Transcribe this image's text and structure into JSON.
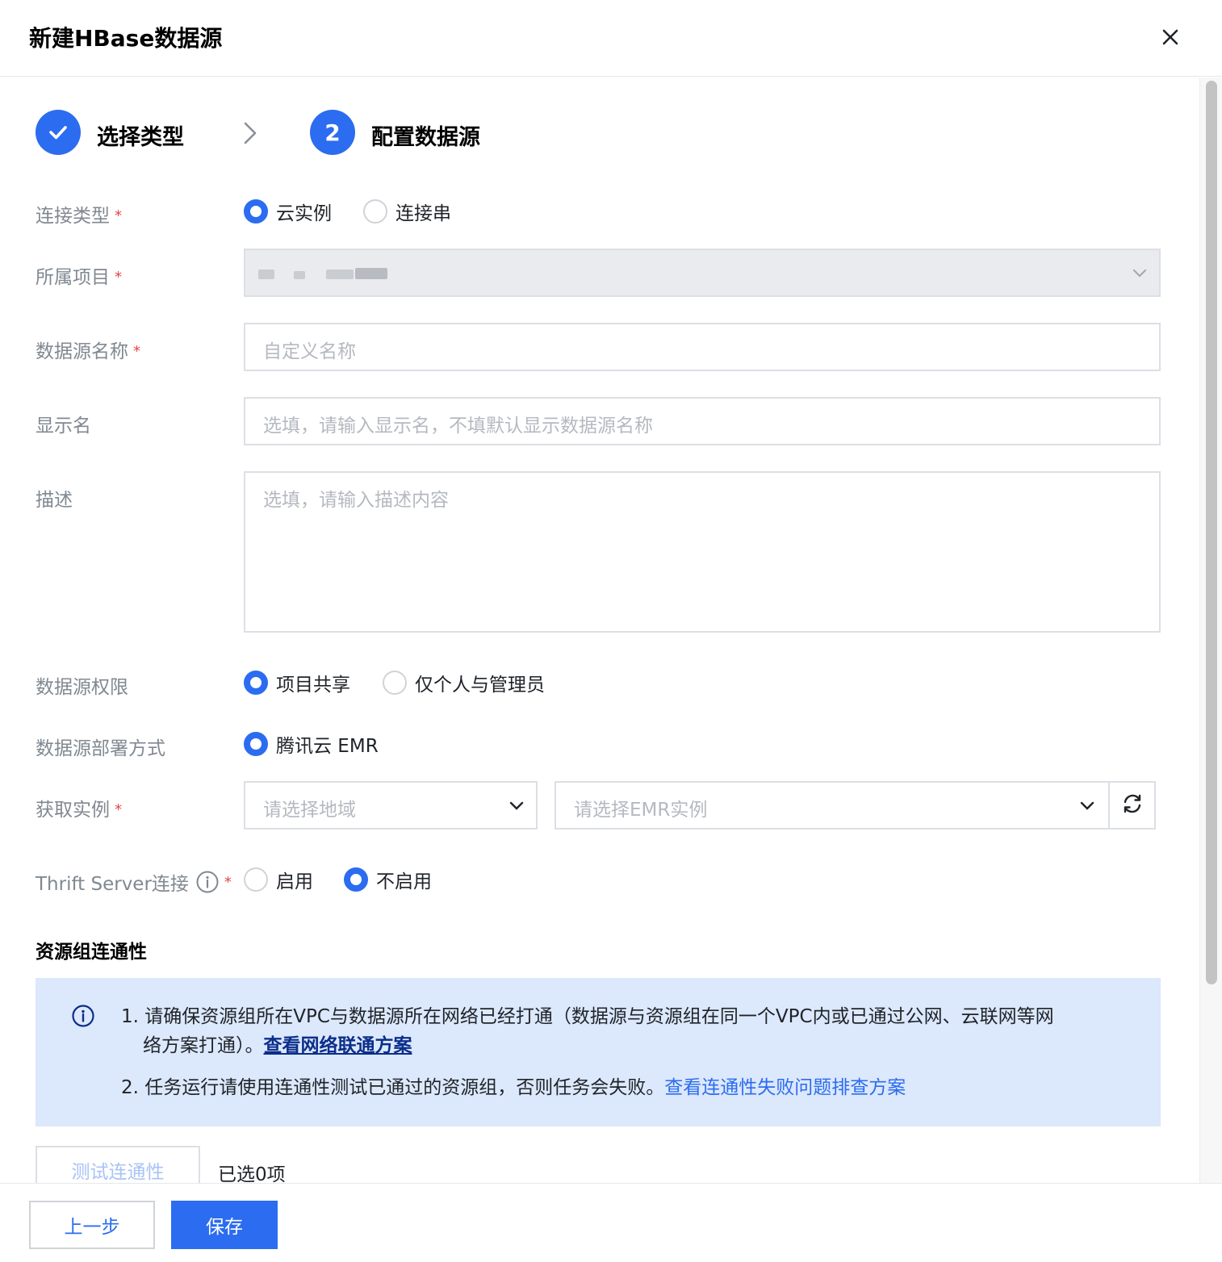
{
  "dialog": {
    "title": "新建HBase数据源"
  },
  "steps": [
    {
      "label": "选择类型",
      "status": "done"
    },
    {
      "number": "2",
      "label": "配置数据源",
      "status": "active"
    }
  ],
  "form": {
    "connection_type": {
      "label": "连接类型",
      "options": [
        "云实例",
        "连接串"
      ],
      "selected": "云实例"
    },
    "project": {
      "label": "所属项目",
      "value": ""
    },
    "name": {
      "label": "数据源名称",
      "placeholder": "自定义名称"
    },
    "display_name": {
      "label": "显示名",
      "placeholder": "选填，请输入显示名，不填默认显示数据源名称"
    },
    "description": {
      "label": "描述",
      "placeholder": "选填，请输入描述内容"
    },
    "permission": {
      "label": "数据源权限",
      "options": [
        "项目共享",
        "仅个人与管理员"
      ],
      "selected": "项目共享"
    },
    "deploy": {
      "label": "数据源部署方式",
      "options": [
        "腾讯云 EMR"
      ],
      "selected": "腾讯云 EMR"
    },
    "instance": {
      "label": "获取实例",
      "region_placeholder": "请选择地域",
      "emr_placeholder": "请选择EMR实例"
    },
    "thrift": {
      "label": "Thrift Server连接",
      "options": [
        "启用",
        "不启用"
      ],
      "selected": "不启用"
    }
  },
  "connectivity": {
    "title": "资源组连通性",
    "notice_1_prefix": "1. 请确保资源组所在VPC与数据源所在网络已经打通（数据源与资源组在同一个VPC内或已通过公网、云联网等网",
    "notice_1_suffix": "络方案打通）。",
    "notice_1_link": "查看网络联通方案",
    "notice_2_prefix": "2. 任务运行请使用连通性测试已通过的资源组，否则任务会失败。",
    "notice_2_link": "查看连通性失败问题排查方案",
    "test_button": "测试连通性",
    "selected_count": "已选0项"
  },
  "footer": {
    "prev": "上一步",
    "save": "保存"
  },
  "colors": {
    "primary": "#2b6cf0",
    "required": "#e54545",
    "notice_bg": "#dce8fb"
  }
}
